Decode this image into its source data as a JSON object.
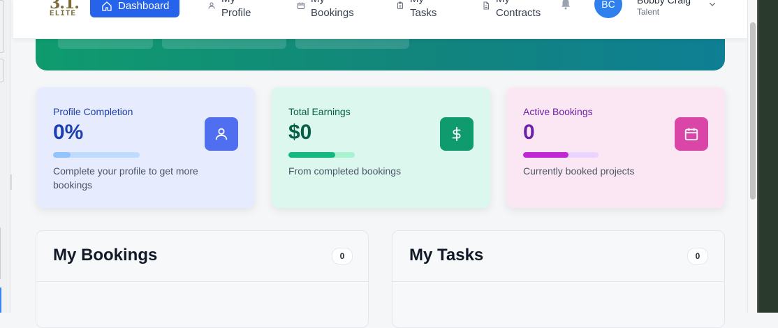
{
  "brand": {
    "logo_top": "3.1.",
    "logo_bottom": "ELITE"
  },
  "nav": {
    "dashboard_label": "Dashboard",
    "items": [
      {
        "line1": "My",
        "line2": "Profile",
        "icon": "user-icon"
      },
      {
        "line1": "My",
        "line2": "Bookings",
        "icon": "calendar-icon"
      },
      {
        "line1": "My",
        "line2": "Tasks",
        "icon": "clipboard-icon"
      },
      {
        "line1": "My",
        "line2": "Contracts",
        "icon": "document-icon"
      }
    ]
  },
  "user": {
    "initials": "BC",
    "name": "Bobby Craig",
    "role": "Talent"
  },
  "stats": [
    {
      "label": "Profile Completion",
      "value": "0%",
      "progress": 0.2,
      "description": "Complete your profile to get more bookings",
      "icon": "user-icon",
      "accent": "#1e40af",
      "icon_color": "#4f6ef0",
      "track": "#bfdbfe",
      "fill": "#93c5fd",
      "bg": "#e6ecfd"
    },
    {
      "label": "Total Earnings",
      "value": "$0",
      "progress": 0.7,
      "description": "From completed bookings",
      "icon": "dollar-icon",
      "accent": "#065f46",
      "icon_color": "#0f9b6e",
      "track": "#a7f3d0",
      "fill": "#10b981",
      "bg": "#dbf7ee"
    },
    {
      "label": "Active Bookings",
      "value": "0",
      "progress": 0.6,
      "description": "Currently booked projects",
      "icon": "calendar-icon",
      "accent": "#6b21a8",
      "icon_color": "#d946a8",
      "track": "#e9d5ff",
      "fill": "#c026d3",
      "bg": "#fbe7f3"
    }
  ],
  "panels": [
    {
      "title": "My Bookings",
      "count": "0"
    },
    {
      "title": "My Tasks",
      "count": "0"
    }
  ]
}
